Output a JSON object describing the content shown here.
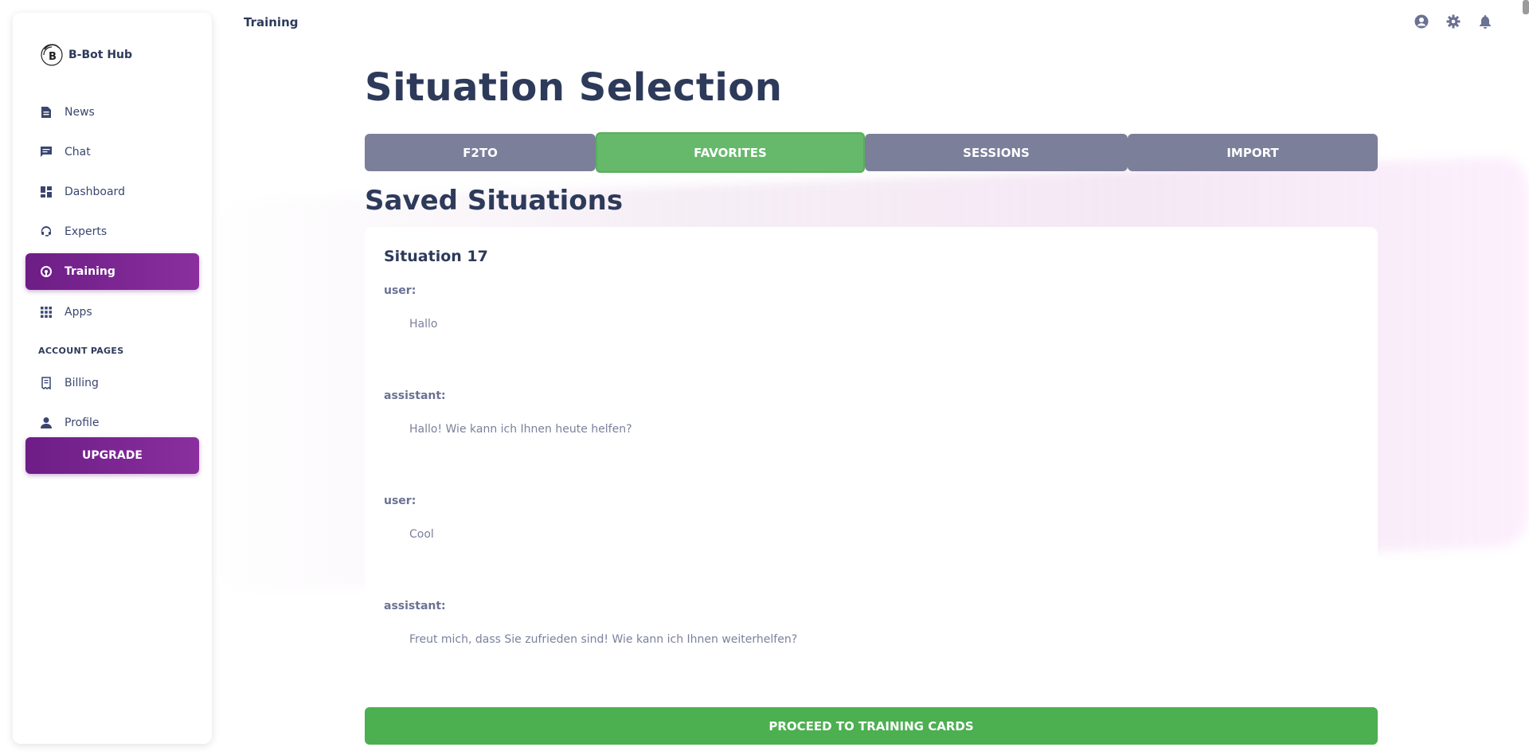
{
  "brand": {
    "name": "B-Bot Hub"
  },
  "header": {
    "title": "Training"
  },
  "sidebar": {
    "items": [
      {
        "label": "News",
        "icon": "news-icon"
      },
      {
        "label": "Chat",
        "icon": "chat-icon"
      },
      {
        "label": "Dashboard",
        "icon": "dashboard-icon"
      },
      {
        "label": "Experts",
        "icon": "experts-icon"
      },
      {
        "label": "Training",
        "icon": "training-icon",
        "active": true
      },
      {
        "label": "Apps",
        "icon": "apps-icon"
      }
    ],
    "section_label": "ACCOUNT PAGES",
    "account_items": [
      {
        "label": "Billing",
        "icon": "billing-icon"
      },
      {
        "label": "Profile",
        "icon": "profile-icon"
      }
    ],
    "upgrade_label": "UPGRADE"
  },
  "main": {
    "title": "Situation Selection",
    "tabs": [
      {
        "label": "F2TO"
      },
      {
        "label": "FAVORITES",
        "active": true
      },
      {
        "label": "SESSIONS"
      },
      {
        "label": "IMPORT"
      }
    ],
    "saved_title": "Saved Situations",
    "situation": {
      "title": "Situation 17",
      "messages": [
        {
          "role": "user:",
          "text": "Hallo"
        },
        {
          "role": "assistant:",
          "text": "Hallo! Wie kann ich Ihnen heute helfen?"
        },
        {
          "role": "user:",
          "text": "Cool"
        },
        {
          "role": "assistant:",
          "text": "Freut mich, dass Sie zufrieden sind! Wie kann ich Ihnen weiterhelfen?"
        }
      ]
    },
    "proceed_label": "PROCEED TO TRAINING CARDS"
  },
  "colors": {
    "accent": "#7b2590",
    "tab_active": "#66b96a",
    "tab_inactive": "#7b7f9a",
    "proceed": "#4caf50",
    "text_dark": "#2d3a5a"
  }
}
